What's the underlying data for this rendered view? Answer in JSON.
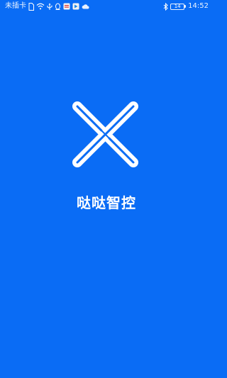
{
  "status_bar": {
    "carrier": "未插卡",
    "battery_level": "14",
    "time": "14:52",
    "icons": [
      "sim-icon",
      "wifi-icon",
      "usb-icon",
      "qq-icon",
      "notification-icon",
      "app-notification-icon",
      "cloud-icon",
      "bluetooth-icon",
      "battery-icon"
    ]
  },
  "splash": {
    "app_name": "哒哒智控",
    "background_color": "#0A6CF5",
    "logo_color": "#FFFFFF",
    "logo_icon": "x-logo-icon"
  }
}
